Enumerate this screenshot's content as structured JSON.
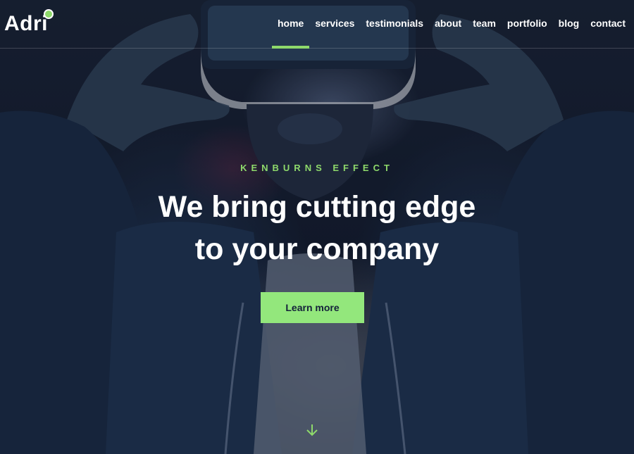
{
  "header": {
    "logo_text": "Adri",
    "nav": [
      {
        "label": "home",
        "active": true
      },
      {
        "label": "services",
        "active": false
      },
      {
        "label": "testimonials",
        "active": false
      },
      {
        "label": "about",
        "active": false
      },
      {
        "label": "team",
        "active": false
      },
      {
        "label": "portfolio",
        "active": false
      },
      {
        "label": "blog",
        "active": false
      },
      {
        "label": "contact",
        "active": false
      }
    ]
  },
  "hero": {
    "eyebrow": "KENBURNS EFFECT",
    "headline_line1": "We bring cutting edge",
    "headline_line2": "to your company",
    "cta_label": "Learn more"
  },
  "theme": {
    "accent": "#93e77c",
    "dark_text": "#14213a"
  },
  "icons": {
    "scroll": "arrow-down-icon"
  }
}
